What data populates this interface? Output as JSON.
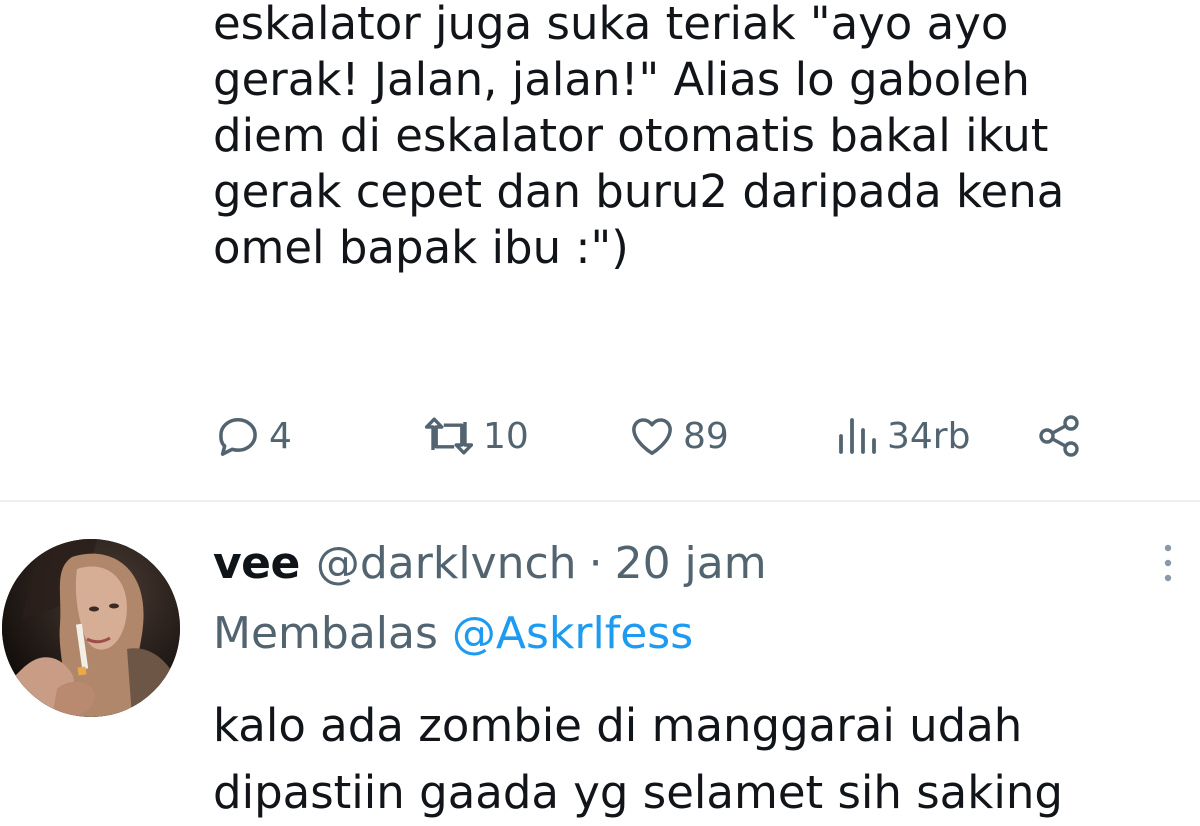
{
  "tweet": {
    "text": "eskalator juga suka teriak \"ayo ayo\ngerak! Jalan, jalan!\" Alias lo gaboleh\ndiem di eskalator otomatis bakal ikut\ngerak cepet dan buru2 daripada kena\nomel bapak ibu :\")",
    "actions": {
      "reply_count": "4",
      "retweet_count": "10",
      "like_count": "89",
      "views_count": "34rb"
    }
  },
  "reply": {
    "name": "vee",
    "handle": "@darklvnch",
    "separator": "·",
    "time": "20 jam",
    "replying_label": "Membalas",
    "replying_to": "@Askrlfess",
    "text": "kalo ada zombie di manggarai udah dipastiin gaada yg selamet sih saking"
  },
  "colors": {
    "text": "#0f1419",
    "secondary": "#536471",
    "link": "#1d9bf0",
    "divider": "#eceff1"
  },
  "icons": [
    "reply-icon",
    "retweet-icon",
    "like-icon",
    "views-icon",
    "share-icon",
    "more-icon"
  ]
}
